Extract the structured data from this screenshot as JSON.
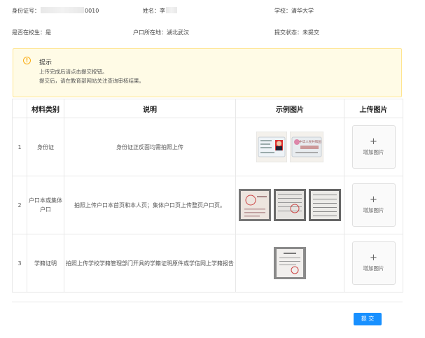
{
  "info": {
    "id_label": "身份证号：",
    "id_suffix": "0010",
    "name_label": "姓名：",
    "name_value": "李",
    "school_label": "学校：",
    "school_value": "清华大学",
    "in_school_label": "是否在校生：",
    "in_school_value": "是",
    "hukou_label": "户口所在地：",
    "hukou_value": "湖北武汉",
    "status_label": "提交状态：",
    "status_value": "未提交"
  },
  "alert": {
    "icon": "exclamation-circle-icon",
    "title": "提示",
    "line1": "上传完成后请点击提交按钮。",
    "line2": "提交后，请在教育部网站关注查询审核结果。"
  },
  "table": {
    "headers": [
      "材料类别",
      "说明",
      "示例图片",
      "上传图片"
    ],
    "rows": [
      {
        "index": "1",
        "category": "身份证",
        "description": "身份证正反面均需拍照上传",
        "upload": "增加图片"
      },
      {
        "index": "2",
        "category": "户口本或集体户口",
        "description": "拍照上传户口本首页和本人页；集体户口页上传整页户口页。",
        "upload": "增加图片"
      },
      {
        "index": "3",
        "category": "学籍证明",
        "description": "拍照上传学校学籍管理部门开具的学籍证明原件或学信网上学籍报告",
        "upload": "增加图片"
      }
    ]
  },
  "id_card_back_text": "中华人民共和国",
  "submit_label": "提 交",
  "colors": {
    "primary": "#1890ff",
    "warning": "#faad14",
    "alert_bg": "#fffbe6",
    "border": "#e8e8e8"
  }
}
